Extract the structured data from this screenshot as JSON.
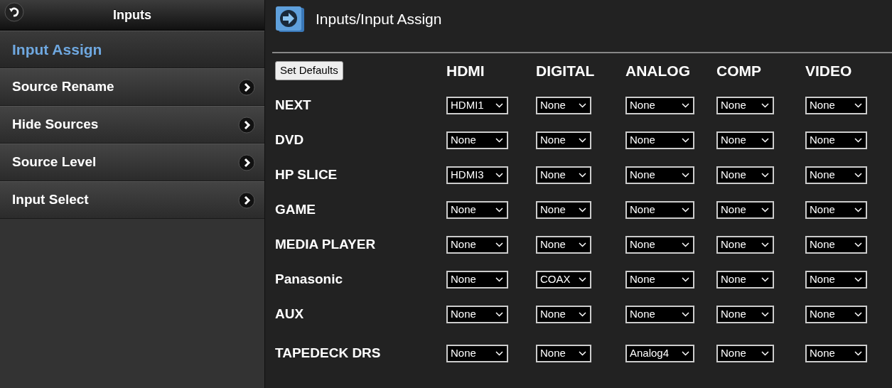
{
  "sidebar": {
    "title": "Inputs",
    "items": [
      {
        "label": "Input Assign",
        "selected": true
      },
      {
        "label": "Source Rename",
        "selected": false
      },
      {
        "label": "Hide Sources",
        "selected": false
      },
      {
        "label": "Source Level",
        "selected": false
      },
      {
        "label": "Input Select",
        "selected": false
      }
    ]
  },
  "header": {
    "title": "Inputs/Input Assign"
  },
  "table": {
    "button": "Set Defaults",
    "columns": [
      "HDMI",
      "DIGITAL",
      "ANALOG",
      "COMP",
      "VIDEO"
    ],
    "rows": [
      {
        "source": "NEXT",
        "values": [
          "HDMI1",
          "None",
          "None",
          "None",
          "None"
        ]
      },
      {
        "source": "DVD",
        "values": [
          "None",
          "None",
          "None",
          "None",
          "None"
        ]
      },
      {
        "source": "HP SLICE",
        "values": [
          "HDMI3",
          "None",
          "None",
          "None",
          "None"
        ]
      },
      {
        "source": "GAME",
        "values": [
          "None",
          "None",
          "None",
          "None",
          "None"
        ]
      },
      {
        "source": "MEDIA PLAYER",
        "values": [
          "None",
          "None",
          "None",
          "None",
          "None"
        ]
      },
      {
        "source": "Panasonic",
        "values": [
          "None",
          "COAX",
          "None",
          "None",
          "None"
        ]
      },
      {
        "source": "AUX",
        "values": [
          "None",
          "None",
          "None",
          "None",
          "None"
        ]
      },
      {
        "source": "TAPEDECK DRS",
        "values": [
          "None",
          "None",
          "Analog4",
          "None",
          "None"
        ]
      }
    ]
  }
}
